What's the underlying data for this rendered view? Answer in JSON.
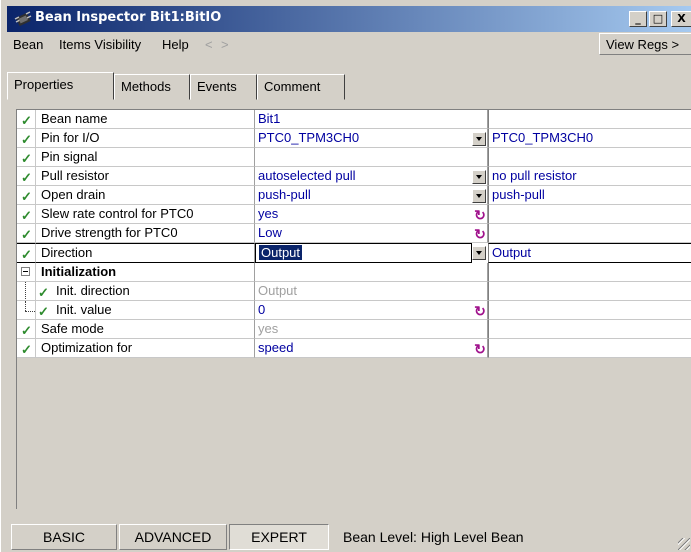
{
  "window": {
    "title": "Bean Inspector Bit1:BitIO",
    "controls": {
      "minimize": "_",
      "maximize": "□",
      "close": "X"
    }
  },
  "menu": {
    "items": [
      "Bean",
      "Items Visibility",
      "Help"
    ],
    "back": "<",
    "forward": ">",
    "view_regs": "View Regs >"
  },
  "tabs": [
    "Properties",
    "Methods",
    "Events",
    "Comment"
  ],
  "active_tab": "Properties",
  "properties": [
    {
      "check": "✓",
      "name": "Bean name",
      "value": "Bit1",
      "value2": ""
    },
    {
      "check": "✓",
      "name": "Pin for I/O",
      "value": "PTC0_TPM3CH0",
      "value2": "PTC0_TPM3CH0"
    },
    {
      "check": "✓",
      "name": "Pin signal",
      "value": "",
      "value2": ""
    },
    {
      "check": "✓",
      "name": "Pull resistor",
      "value": "autoselected pull",
      "value2": "no pull resistor"
    },
    {
      "check": "✓",
      "name": "Open drain",
      "value": "push-pull",
      "value2": "push-pull"
    },
    {
      "check": "✓",
      "name": "Slew rate control for PTC0",
      "value": "yes",
      "value2": ""
    },
    {
      "check": "✓",
      "name": "Drive strength for PTC0",
      "value": "Low",
      "value2": ""
    },
    {
      "check": "✓",
      "name": "Direction",
      "value": "Output",
      "value2": "Output"
    },
    {
      "check": "",
      "name": "Initialization",
      "value": "",
      "value2": ""
    },
    {
      "check": "✓",
      "name": "Init. direction",
      "value": "Output",
      "value2": ""
    },
    {
      "check": "✓",
      "name": "Init. value",
      "value": "0",
      "value2": ""
    },
    {
      "check": "✓",
      "name": "Safe mode",
      "value": "yes",
      "value2": ""
    },
    {
      "check": "✓",
      "name": "Optimization for",
      "value": "speed",
      "value2": ""
    }
  ],
  "status": {
    "basic": "BASIC",
    "advanced": "ADVANCED",
    "expert": "EXPERT",
    "level": "Bean Level: High Level Bean"
  },
  "icons": {
    "reset": "↻",
    "dropdown": "chevron-down-icon"
  },
  "colors": {
    "title_start": "#0a246a",
    "title_end": "#a6caf0",
    "value_text": "#0000a0",
    "check": "#2e8b2e",
    "reset_icon": "#a0118c"
  }
}
